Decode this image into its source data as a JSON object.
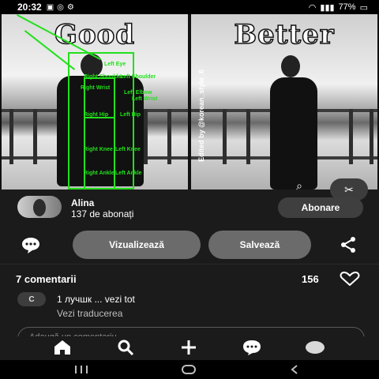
{
  "statusbar": {
    "time": "20:32",
    "status_icons": [
      "gallery-icon",
      "instagram-icon",
      "settings-icon"
    ],
    "battery": "77%"
  },
  "photo": {
    "left_word": "Good",
    "right_word": "Better",
    "watermark": "Edited by @korean_style_6",
    "pose_labels": [
      "Left Eye",
      "Right Shoulder",
      "Left Shoulder",
      "Right Wrist",
      "Left Elbow",
      "Left Wrist",
      "Right Hip",
      "Left Hip",
      "Right Knee",
      "Left Knee",
      "Right Ankle",
      "Left Ankle"
    ]
  },
  "creator": {
    "name": "Alina",
    "followers": "137 de abonați",
    "follow_label": "Abonare"
  },
  "actions": {
    "visualize_label": "Vizualizează",
    "save_label": "Salvează"
  },
  "comments": {
    "title": "7 comentarii",
    "like_count": "156",
    "items": [
      {
        "avatar_letter": "C",
        "text": "1 лучшк ... vezi tot"
      }
    ],
    "translate_label": "Vezi traducerea",
    "input_placeholder": "Adaugă un comentariu"
  },
  "tabbar": {
    "items": [
      "home-icon",
      "search-icon",
      "add-icon",
      "messages-icon",
      "profile-icon"
    ]
  },
  "navbar": {
    "items": [
      "recents-icon",
      "home-nav-icon",
      "back-icon"
    ]
  },
  "colors": {
    "pose_green": "#22e01b",
    "button_gray": "#6b6b6b",
    "background": "#1b1b1b"
  }
}
